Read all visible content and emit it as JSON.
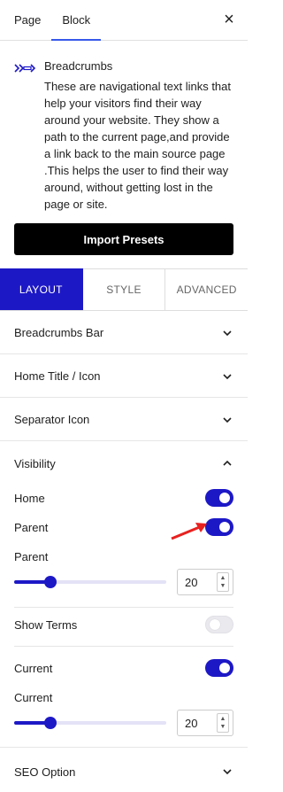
{
  "topbar": {
    "tabs": [
      {
        "label": "Page",
        "active": false
      },
      {
        "label": "Block",
        "active": true
      }
    ],
    "close_icon": "close-icon"
  },
  "block": {
    "icon": "breadcrumb-arrows-icon",
    "title": "Breadcrumbs",
    "description": "These are navigational text links that help your visitors find their way around your website. They show a path to the current page,and provide a link back to the main source page .This helps the user to find their way around, without getting lost in the page or site."
  },
  "import_button": {
    "label": "Import Presets"
  },
  "panel_tabs": [
    {
      "label": "LAYOUT",
      "active": true
    },
    {
      "label": "STYLE",
      "active": false
    },
    {
      "label": "ADVANCED",
      "active": false
    }
  ],
  "sections": {
    "breadcrumbs_bar": {
      "label": "Breadcrumbs Bar",
      "expanded": false
    },
    "home_title": {
      "label": "Home Title / Icon",
      "expanded": false
    },
    "separator": {
      "label": "Separator Icon",
      "expanded": false
    },
    "visibility": {
      "label": "Visibility",
      "expanded": true
    },
    "seo": {
      "label": "SEO Option",
      "expanded": false
    }
  },
  "visibility": {
    "home": {
      "label": "Home",
      "on": true
    },
    "parent": {
      "label": "Parent",
      "on": true
    },
    "parent_slider": {
      "label": "Parent",
      "value": "20",
      "fraction": 0.24
    },
    "show_terms": {
      "label": "Show Terms",
      "on": false
    },
    "current": {
      "label": "Current",
      "on": true
    },
    "current_slider": {
      "label": "Current",
      "value": "20",
      "fraction": 0.24
    }
  },
  "colors": {
    "accent": "#1d18c6",
    "annotation_arrow": "#e8211f"
  }
}
